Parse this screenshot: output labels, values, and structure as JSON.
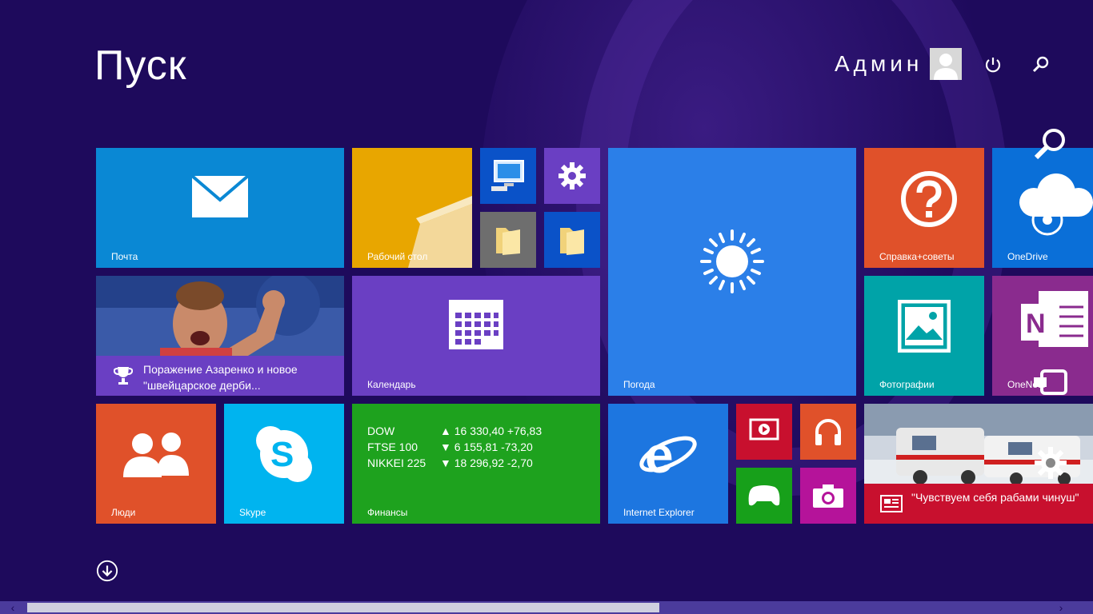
{
  "header": {
    "title": "Пуск",
    "user_name": "Админ",
    "power_icon": "power-icon",
    "search_icon": "search-icon"
  },
  "tiles": {
    "mail": {
      "label": "Почта",
      "color": "#0a88d4"
    },
    "desktop": {
      "label": "Рабочий стол",
      "color": "#e8a600"
    },
    "calendar": {
      "label": "Календарь",
      "color": "#6a3fc3"
    },
    "weather": {
      "label": "Погода",
      "color": "#2b7fe8"
    },
    "help": {
      "label": "Справка+советы",
      "color": "#e0512a"
    },
    "onedrive": {
      "label": "OneDrive",
      "color": "#0a6fd8"
    },
    "photos": {
      "label": "Фотографии",
      "color": "#00a3a8"
    },
    "onenote": {
      "label": "OneNote",
      "color": "#8a2b8e"
    },
    "people": {
      "label": "Люди",
      "color": "#e0512a"
    },
    "skype": {
      "label": "Skype",
      "color": "#00b4ef"
    },
    "finance": {
      "label": "Финансы",
      "color": "#1ea21e",
      "rows": [
        {
          "name": "DOW",
          "dir": "▲",
          "value": "16 330,40 +76,83"
        },
        {
          "name": "FTSE 100",
          "dir": "▼",
          "value": "6 155,81 -73,20"
        },
        {
          "name": "NIKKEI 225",
          "dir": "▼",
          "value": "18 296,92 -2,70"
        }
      ]
    },
    "ie": {
      "label": "Internet Explorer",
      "color": "#1d76e0"
    },
    "sport": {
      "text": "Поражение Азаренко и новое \"швейцарское дерби...",
      "color": "#6a3fc3"
    },
    "news": {
      "text": "\"Чувствуем себя рабами чинуш\"",
      "color": "#c8102e"
    }
  },
  "small_tiles": [
    "computer-icon",
    "settings-icon",
    "folder-icon",
    "folder-icon",
    "video-icon",
    "music-icon",
    "games-icon",
    "camera-icon"
  ]
}
